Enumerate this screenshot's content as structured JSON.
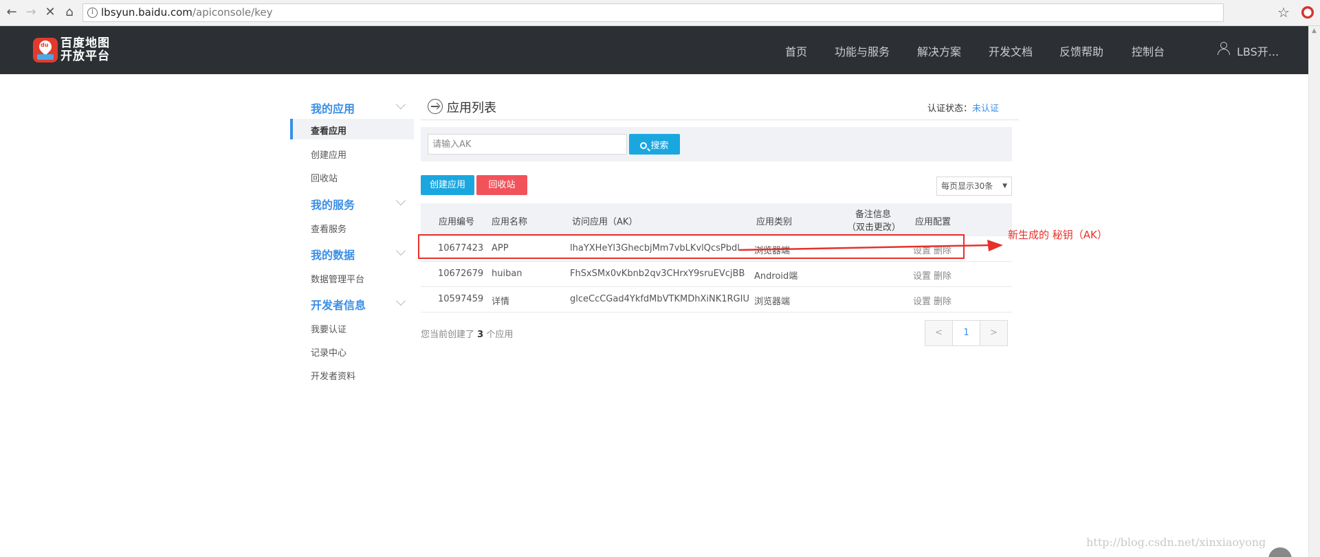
{
  "browser": {
    "url_host": "lbsyun.baidu.com",
    "url_path": "/apiconsole/key",
    "icons": [
      "back-icon",
      "forward-icon",
      "stop-icon",
      "home-icon",
      "info-icon",
      "star-icon",
      "extension-icon"
    ]
  },
  "header": {
    "logo_line1": "百度地图",
    "logo_line2": "开放平台",
    "logo_badge": "du",
    "nav": [
      "首页",
      "功能与服务",
      "解决方案",
      "开发文档",
      "反馈帮助",
      "控制台"
    ],
    "user": "LBS开..."
  },
  "sidebar": {
    "sections": [
      {
        "title": "我的应用",
        "items": [
          "查看应用",
          "创建应用",
          "回收站"
        ],
        "active": "查看应用"
      },
      {
        "title": "我的服务",
        "items": [
          "查看服务"
        ]
      },
      {
        "title": "我的数据",
        "items": [
          "数据管理平台"
        ]
      },
      {
        "title": "开发者信息",
        "items": [
          "我要认证",
          "记录中心",
          "开发者资料"
        ]
      }
    ]
  },
  "main": {
    "title": "应用列表",
    "auth_label": "认证状态：",
    "auth_value": "未认证",
    "search_placeholder": "请输入AK",
    "search_button": "搜索",
    "create_button": "创建应用",
    "recycle_button": "回收站",
    "per_page": "每页显示30条",
    "columns": [
      "应用编号",
      "应用名称",
      "访问应用（AK）",
      "应用类别",
      "备注信息",
      "（双击更改）",
      "应用配置"
    ],
    "rows": [
      {
        "id": "10677423",
        "name": "APP",
        "ak": "lhaYXHeYl3GhecbjMm7vbLKvlQcsPbdl",
        "type": "浏览器端",
        "note": "",
        "actions": [
          "设置",
          "删除"
        ]
      },
      {
        "id": "10672679",
        "name": "huiban",
        "ak": "FhSxSMx0vKbnb2qv3CHrxY9sruEVcjBB",
        "type": "Android端",
        "note": "",
        "actions": [
          "设置",
          "删除"
        ]
      },
      {
        "id": "10597459",
        "name": "详情",
        "ak": "glceCcCGad4YkfdMbVTKMDhXiNK1RGIU",
        "type": "浏览器端",
        "note": "",
        "actions": [
          "设置",
          "删除"
        ]
      }
    ],
    "summary_prefix": "您当前创建了",
    "summary_count": "3",
    "summary_suffix": "个应用",
    "pagination": {
      "prev": "<",
      "current": "1",
      "next": ">"
    }
  },
  "annotation": {
    "label": "新生成的 秘钥（AK）",
    "color": "#e8302a"
  },
  "watermark": "http://blog.csdn.net/xinxiaoyong",
  "colors": {
    "header_bg": "#2c3034",
    "accent_blue": "#1aa7e0",
    "link_blue": "#3a8ee6",
    "danger_red": "#f2525a"
  }
}
